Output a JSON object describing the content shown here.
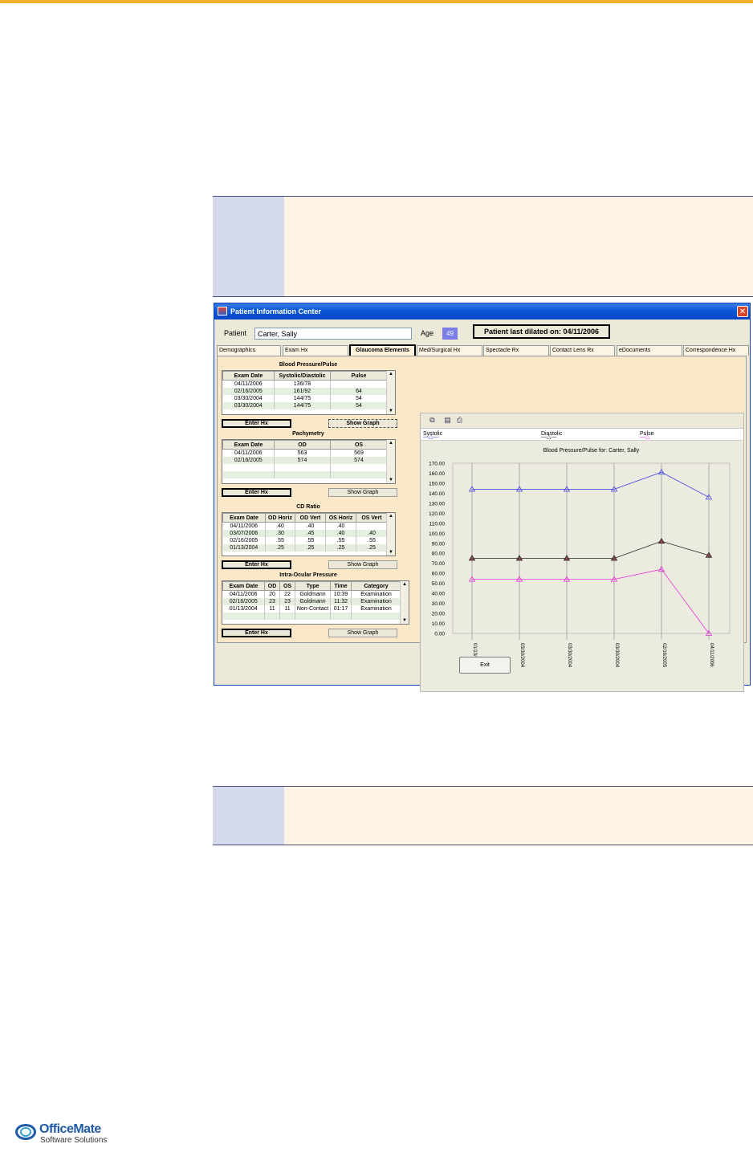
{
  "window": {
    "title": "Patient Information Center",
    "close": "✕"
  },
  "patient": {
    "label": "Patient",
    "name": "Carter, Sally",
    "age_label": "Age",
    "age": "49",
    "dilated": "Patient last dilated on: 04/11/2006"
  },
  "tabs": [
    "Demographics",
    "Exam Hx",
    "Glaucoma Elements",
    "Med/Surgical Hx",
    "Spectacle Rx",
    "Contact Lens Rx",
    "eDocuments",
    "Correspondence Hx"
  ],
  "bp": {
    "title": "Blood Pressure/Pulse",
    "headers": [
      "Exam Date",
      "Systolic/Diastolic",
      "Pulse"
    ],
    "rows": [
      [
        "04/11/2006",
        "136/78",
        ""
      ],
      [
        "02/16/2005",
        "161/92",
        "64"
      ],
      [
        "03/30/2004",
        "144/75",
        "54"
      ],
      [
        "03/30/2004",
        "144/75",
        "54"
      ]
    ],
    "enter_btn": "Enter Hx",
    "graph_btn": "Show Graph"
  },
  "pachymetry": {
    "title": "Pachymetry",
    "headers": [
      "Exam Date",
      "OD",
      "OS"
    ],
    "rows": [
      [
        "04/11/2006",
        "563",
        "569"
      ],
      [
        "02/16/2005",
        "574",
        "574"
      ]
    ],
    "enter_btn": "Enter Hx",
    "graph_btn": "Show Graph"
  },
  "cd": {
    "title": "CD Ratio",
    "headers": [
      "Exam Date",
      "OD Horiz",
      "OD Vert",
      "OS Horiz",
      "OS Vert"
    ],
    "rows": [
      [
        "04/11/2006",
        ".40",
        ".40",
        ".40",
        ""
      ],
      [
        "03/07/2006",
        ".30",
        ".45",
        ".40",
        ".40"
      ],
      [
        "02/16/2005",
        ".55",
        ".55",
        ".55",
        ".55"
      ],
      [
        "01/13/2004",
        ".25",
        ".25",
        ".25",
        ".25"
      ]
    ],
    "enter_btn": "Enter Hx",
    "graph_btn": "Show Graph"
  },
  "iop": {
    "title": "Intra-Ocular Pressure",
    "headers": [
      "Exam Date",
      "OD",
      "OS",
      "Type",
      "Time",
      "Category"
    ],
    "rows": [
      [
        "04/11/2006",
        "20",
        "22",
        "Goldmann",
        "10:39",
        "Examination"
      ],
      [
        "02/16/2005",
        "23",
        "23",
        "Goldmann",
        "11:32",
        "Examination"
      ],
      [
        "01/13/2004",
        "11",
        "11",
        "Non-Contact",
        "01:17",
        "Examination"
      ]
    ],
    "enter_btn": "Enter Hx",
    "graph_btn": "Show Graph"
  },
  "exit_btn": "Exit",
  "logo": {
    "line1": "OfficeMate",
    "line2": "Software Solutions"
  },
  "colors": {
    "systolic": "#4a4ae6",
    "diastolic": "#222222",
    "pulse": "#e632d6",
    "accent": "#f2b22e"
  },
  "chart_data": {
    "type": "line",
    "title": "Blood Pressure/Pulse for: Carter, Sally",
    "categories": [
      "01/13/2004",
      "03/30/2004",
      "03/30/2004",
      "03/30/2004",
      "02/16/2005",
      "04/11/2006"
    ],
    "series": [
      {
        "name": "Systolic",
        "values": [
          144,
          144,
          144,
          144,
          161,
          136
        ]
      },
      {
        "name": "Diastolic",
        "values": [
          75,
          75,
          75,
          75,
          92,
          78
        ]
      },
      {
        "name": "Pulse",
        "values": [
          54,
          54,
          54,
          54,
          64,
          0
        ]
      }
    ],
    "ylim": [
      0,
      170
    ],
    "yticks": [
      "0.00",
      "10.00",
      "20.00",
      "30.00",
      "40.00",
      "50.00",
      "60.00",
      "70.00",
      "80.00",
      "90.00",
      "100.00",
      "110.00",
      "120.00",
      "130.00",
      "140.00",
      "150.00",
      "160.00",
      "170.00"
    ],
    "grid": true,
    "legend": "top"
  }
}
